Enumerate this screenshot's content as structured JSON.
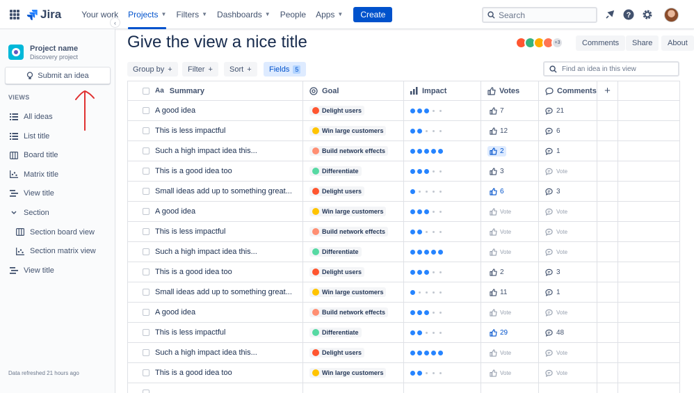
{
  "nav": {
    "logo": "Jira",
    "items": [
      {
        "label": "Your work",
        "caret": false,
        "active": false
      },
      {
        "label": "Projects",
        "caret": true,
        "active": true
      },
      {
        "label": "Filters",
        "caret": true,
        "active": false
      },
      {
        "label": "Dashboards",
        "caret": true,
        "active": false
      },
      {
        "label": "People",
        "caret": false,
        "active": false
      },
      {
        "label": "Apps",
        "caret": true,
        "active": false
      }
    ],
    "create_label": "Create",
    "search_placeholder": "Search"
  },
  "sidebar": {
    "project_name": "Project name",
    "project_type": "Discovery project",
    "submit_label": "Submit an idea",
    "views_label": "VIEWS",
    "views": [
      {
        "label": "All ideas",
        "icon": "list-icon"
      },
      {
        "label": "List title",
        "icon": "list-icon"
      },
      {
        "label": "Board title",
        "icon": "board-icon"
      },
      {
        "label": "Matrix title",
        "icon": "matrix-icon"
      },
      {
        "label": "View title",
        "icon": "timeline-icon"
      },
      {
        "label": "Section",
        "icon": "chevron-down-icon"
      },
      {
        "label": "Section board view",
        "icon": "board-icon"
      },
      {
        "label": "Section matrix view",
        "icon": "matrix-icon"
      },
      {
        "label": "View title",
        "icon": "timeline-icon"
      }
    ],
    "refresh_text": "Data refreshed 21 hours ago"
  },
  "main": {
    "title": "Give the view a nice title",
    "avatar_more": "+3",
    "comments_label": "Comments",
    "share_label": "Share",
    "about_label": "About",
    "toolbar": {
      "group_by": "Group by",
      "filter": "Filter",
      "sort": "Sort",
      "fields": "Fields",
      "fields_count": "5",
      "find_placeholder": "Find an idea in this view"
    }
  },
  "table": {
    "columns": {
      "summary": "Summary",
      "goal": "Goal",
      "impact": "Impact",
      "votes": "Votes",
      "comments": "Comments"
    },
    "rows": [
      {
        "summary": "A good idea",
        "goal": "Delight users",
        "impact": 3,
        "votes": "7",
        "comments": "21"
      },
      {
        "summary": "This is less impactful",
        "goal": "Win large customers",
        "impact": 2,
        "votes": "12",
        "comments": "6"
      },
      {
        "summary": "Such a high impact idea this...",
        "goal": "Build network effects",
        "impact": 5,
        "votes": "2",
        "comments": "1",
        "votes_selected": true
      },
      {
        "summary": "This is a good idea too",
        "goal": "Differentiate",
        "impact": 3,
        "votes": "3",
        "comments": null
      },
      {
        "summary": "Small ideas add up to something great...",
        "goal": "Delight users",
        "impact": 1,
        "votes": "6",
        "comments": "3",
        "votes_highlight": true
      },
      {
        "summary": "A good idea",
        "goal": "Win large customers",
        "impact": 3,
        "votes": null,
        "comments": null
      },
      {
        "summary": "This is less impactful",
        "goal": "Build network effects",
        "impact": 2,
        "votes": null,
        "comments": null
      },
      {
        "summary": "Such a high impact idea this...",
        "goal": "Differentiate",
        "impact": 5,
        "votes": null,
        "comments": null
      },
      {
        "summary": "This is a good idea too",
        "goal": "Delight users",
        "impact": 3,
        "votes": "2",
        "comments": "3"
      },
      {
        "summary": "Small ideas add up to something great...",
        "goal": "Win large customers",
        "impact": 1,
        "votes": "11",
        "comments": "1"
      },
      {
        "summary": "A good idea",
        "goal": "Build network effects",
        "impact": 3,
        "votes": null,
        "comments": null
      },
      {
        "summary": "This is less impactful",
        "goal": "Differentiate",
        "impact": 2,
        "votes": "29",
        "comments": "48",
        "votes_highlight": true
      },
      {
        "summary": "Such a high impact idea this...",
        "goal": "Delight users",
        "impact": 5,
        "votes": null,
        "comments": null
      },
      {
        "summary": "This is a good idea too",
        "goal": "Win large customers",
        "impact": 2,
        "votes": null,
        "comments": null
      },
      {
        "summary": "",
        "goal": "",
        "impact": 0,
        "votes": null,
        "comments": null
      }
    ],
    "vote_placeholder": "Vote",
    "impact_max": 5
  },
  "colors": {
    "accent": "#0052cc",
    "dot": "#2684ff",
    "annotation": "#e03131"
  }
}
